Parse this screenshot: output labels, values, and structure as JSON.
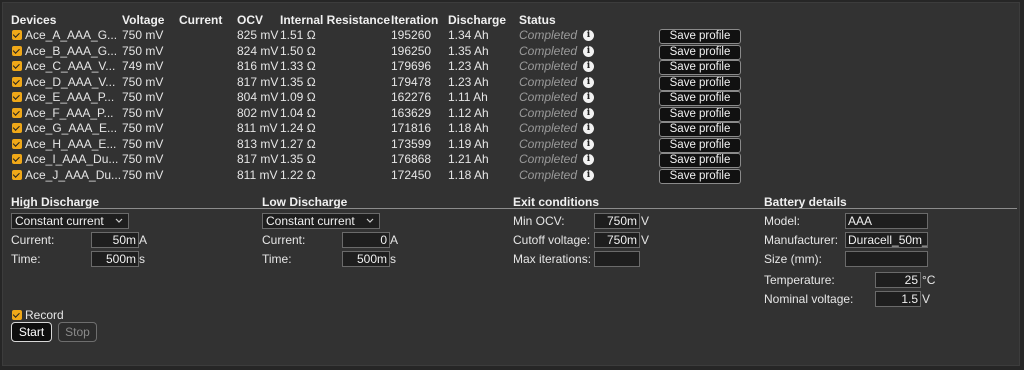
{
  "table": {
    "headers": {
      "devices": "Devices",
      "voltage": "Voltage",
      "current": "Current",
      "ocv": "OCV",
      "resistance": "Internal Resistance",
      "iteration": "Iteration",
      "discharge": "Discharge",
      "status": "Status"
    },
    "save_label": "Save profile",
    "rows": [
      {
        "name": "Ace_A_AAA_G...",
        "voltage": "750 mV",
        "current": "",
        "ocv": "825 mV",
        "resistance": "1.51 Ω",
        "iteration": "195260",
        "discharge": "1.34 Ah",
        "status": "Completed",
        "checked": true
      },
      {
        "name": "Ace_B_AAA_G...",
        "voltage": "750 mV",
        "current": "",
        "ocv": "824 mV",
        "resistance": "1.50 Ω",
        "iteration": "196250",
        "discharge": "1.35 Ah",
        "status": "Completed",
        "checked": true
      },
      {
        "name": "Ace_C_AAA_V...",
        "voltage": "749 mV",
        "current": "",
        "ocv": "816 mV",
        "resistance": "1.33 Ω",
        "iteration": "179696",
        "discharge": "1.23 Ah",
        "status": "Completed",
        "checked": true
      },
      {
        "name": "Ace_D_AAA_V...",
        "voltage": "750 mV",
        "current": "",
        "ocv": "817 mV",
        "resistance": "1.35 Ω",
        "iteration": "179478",
        "discharge": "1.23 Ah",
        "status": "Completed",
        "checked": true
      },
      {
        "name": "Ace_E_AAA_P...",
        "voltage": "750 mV",
        "current": "",
        "ocv": "804 mV",
        "resistance": "1.09 Ω",
        "iteration": "162276",
        "discharge": "1.11 Ah",
        "status": "Completed",
        "checked": true
      },
      {
        "name": "Ace_F_AAA_P...",
        "voltage": "750 mV",
        "current": "",
        "ocv": "802 mV",
        "resistance": "1.04 Ω",
        "iteration": "163629",
        "discharge": "1.12 Ah",
        "status": "Completed",
        "checked": true
      },
      {
        "name": "Ace_G_AAA_E...",
        "voltage": "750 mV",
        "current": "",
        "ocv": "811 mV",
        "resistance": "1.24 Ω",
        "iteration": "171816",
        "discharge": "1.18 Ah",
        "status": "Completed",
        "checked": true
      },
      {
        "name": "Ace_H_AAA_E...",
        "voltage": "750 mV",
        "current": "",
        "ocv": "813 mV",
        "resistance": "1.27 Ω",
        "iteration": "173599",
        "discharge": "1.19 Ah",
        "status": "Completed",
        "checked": true
      },
      {
        "name": "Ace_I_AAA_Du...",
        "voltage": "750 mV",
        "current": "",
        "ocv": "817 mV",
        "resistance": "1.35 Ω",
        "iteration": "176868",
        "discharge": "1.21 Ah",
        "status": "Completed",
        "checked": true
      },
      {
        "name": "Ace_J_AAA_Du...",
        "voltage": "750 mV",
        "current": "",
        "ocv": "811 mV",
        "resistance": "1.22 Ω",
        "iteration": "172450",
        "discharge": "1.18 Ah",
        "status": "Completed",
        "checked": true
      }
    ]
  },
  "high_discharge": {
    "title": "High Discharge",
    "mode": "Constant current",
    "current_label": "Current:",
    "current_value": "50m",
    "current_unit": "A",
    "time_label": "Time:",
    "time_value": "500m",
    "time_unit": "s"
  },
  "low_discharge": {
    "title": "Low Discharge",
    "mode": "Constant current",
    "current_label": "Current:",
    "current_value": "0",
    "current_unit": "A",
    "time_label": "Time:",
    "time_value": "500m",
    "time_unit": "s"
  },
  "exit_conditions": {
    "title": "Exit conditions",
    "min_ocv_label": "Min OCV:",
    "min_ocv_value": "750m",
    "min_ocv_unit": "V",
    "cutoff_label": "Cutoff voltage:",
    "cutoff_value": "750m",
    "cutoff_unit": "V",
    "max_iter_label": "Max iterations:",
    "max_iter_value": ""
  },
  "battery_details": {
    "title": "Battery details",
    "model_label": "Model:",
    "model_value": "AAA",
    "manufacturer_label": "Manufacturer:",
    "manufacturer_value": "Duracell_50m_",
    "size_label": "Size (mm):",
    "size_value": "",
    "temperature_label": "Temperature:",
    "temperature_value": "25",
    "temperature_unit": "°C",
    "nominal_label": "Nominal voltage:",
    "nominal_value": "1.5",
    "nominal_unit": "V"
  },
  "record": {
    "label": "Record",
    "checked": true
  },
  "buttons": {
    "start": "Start",
    "stop": "Stop"
  },
  "colors": {
    "accent": "#f0a818",
    "background": "#323232",
    "status_text": "#9a9a9a"
  },
  "icons": {
    "info": "info-icon",
    "checkbox": "checkbox-checked-icon",
    "select_caret": "chevron-down-icon"
  }
}
